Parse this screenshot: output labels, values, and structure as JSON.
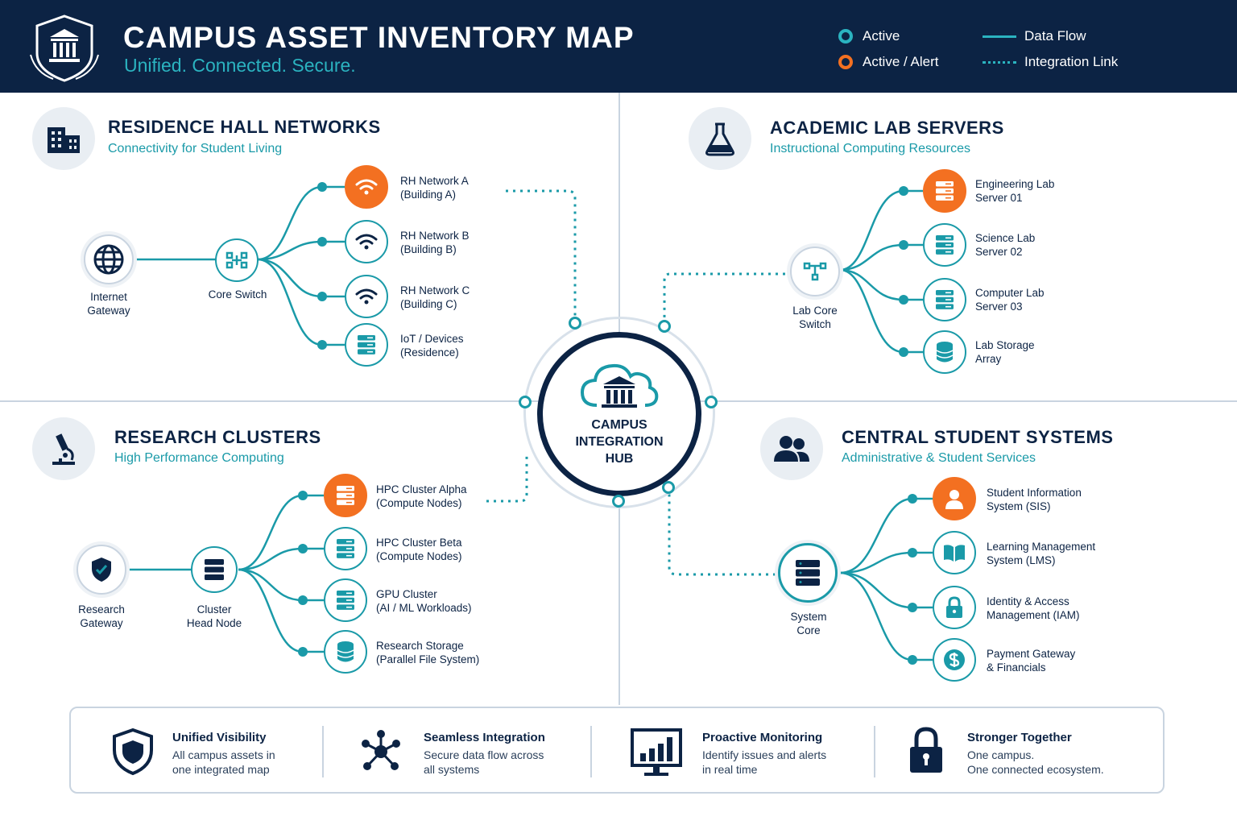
{
  "header": {
    "title": "CAMPUS ASSET INVENTORY MAP",
    "subtitle": "Unified. Connected. Secure.",
    "legend": {
      "active": "Active",
      "alert": "Active / Alert",
      "data_flow": "Data Flow",
      "integration_link": "Integration Link"
    }
  },
  "colors": {
    "navy": "#0c2344",
    "teal": "#1a9aa8",
    "alert_orange": "#f37021",
    "divider": "#c9d4e0"
  },
  "hub": {
    "label_line1": "CAMPUS",
    "label_line2": "INTEGRATION",
    "label_line3": "HUB"
  },
  "residence": {
    "title": "RESIDENCE HALL NETWORKS",
    "subtitle": "Connectivity for Student Living",
    "gateway": {
      "line1": "Internet",
      "line2": "Gateway"
    },
    "switch": "Core Switch",
    "nodes": [
      {
        "line1": "RH Network A",
        "line2": "(Building A)",
        "status": "alert",
        "icon": "wifi-icon"
      },
      {
        "line1": "RH Network B",
        "line2": "(Building B)",
        "status": "active",
        "icon": "wifi-icon"
      },
      {
        "line1": "RH Network C",
        "line2": "(Building C)",
        "status": "active",
        "icon": "wifi-icon"
      },
      {
        "line1": "IoT / Devices",
        "line2": "(Residence)",
        "status": "active",
        "icon": "server-icon"
      }
    ]
  },
  "academic": {
    "title": "ACADEMIC LAB SERVERS",
    "subtitle": "Instructional Computing Resources",
    "switch": {
      "line1": "Lab Core",
      "line2": "Switch"
    },
    "nodes": [
      {
        "line1": "Engineering Lab",
        "line2": "Server 01",
        "status": "alert",
        "icon": "server-icon"
      },
      {
        "line1": "Science Lab",
        "line2": "Server 02",
        "status": "active",
        "icon": "server-icon"
      },
      {
        "line1": "Computer Lab",
        "line2": "Server 03",
        "status": "active",
        "icon": "server-icon"
      },
      {
        "line1": "Lab Storage",
        "line2": "Array",
        "status": "active",
        "icon": "database-icon"
      }
    ]
  },
  "research": {
    "title": "RESEARCH CLUSTERS",
    "subtitle": "High Performance Computing",
    "gateway": {
      "line1": "Research",
      "line2": "Gateway"
    },
    "head": {
      "line1": "Cluster",
      "line2": "Head Node"
    },
    "nodes": [
      {
        "line1": "HPC Cluster Alpha",
        "line2": "(Compute Nodes)",
        "status": "alert",
        "icon": "server-icon"
      },
      {
        "line1": "HPC Cluster Beta",
        "line2": "(Compute Nodes)",
        "status": "active",
        "icon": "server-icon"
      },
      {
        "line1": "GPU Cluster",
        "line2": "(AI / ML Workloads)",
        "status": "active",
        "icon": "server-icon"
      },
      {
        "line1": "Research Storage",
        "line2": "(Parallel File System)",
        "status": "active",
        "icon": "database-icon"
      }
    ]
  },
  "student": {
    "title": "CENTRAL STUDENT SYSTEMS",
    "subtitle": "Administrative & Student Services",
    "core": {
      "line1": "System",
      "line2": "Core"
    },
    "nodes": [
      {
        "line1": "Student Information",
        "line2": "System (SIS)",
        "status": "alert",
        "icon": "user-icon"
      },
      {
        "line1": "Learning Management",
        "line2": "System (LMS)",
        "status": "active",
        "icon": "book-icon"
      },
      {
        "line1": "Identity & Access",
        "line2": "Management (IAM)",
        "status": "active",
        "icon": "lock-icon"
      },
      {
        "line1": "Payment Gateway",
        "line2": "& Financials",
        "status": "active",
        "icon": "dollar-icon"
      }
    ]
  },
  "footer": [
    {
      "title": "Unified Visibility",
      "line1": "All campus assets in",
      "line2": "one integrated map",
      "icon": "shield-icon"
    },
    {
      "title": "Seamless Integration",
      "line1": "Secure data flow across",
      "line2": "all systems",
      "icon": "network-icon"
    },
    {
      "title": "Proactive Monitoring",
      "line1": "Identify issues and alerts",
      "line2": "in real time",
      "icon": "monitor-chart-icon"
    },
    {
      "title": "Stronger Together",
      "line1": "One campus.",
      "line2": "One connected ecosystem.",
      "icon": "padlock-icon"
    }
  ]
}
